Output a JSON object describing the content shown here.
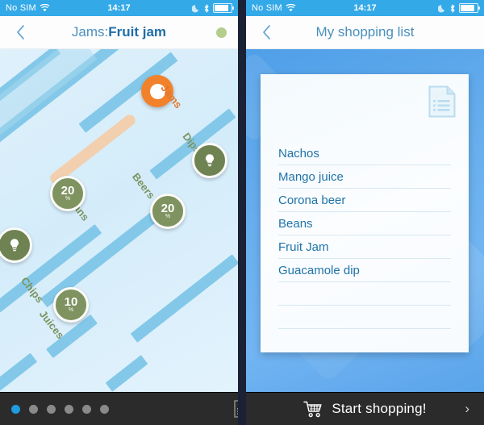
{
  "status_bar": {
    "carrier": "No SIM",
    "time": "14:17",
    "wifi_icon": "wifi-icon",
    "moon_icon": "moon-icon",
    "bluetooth_icon": "bluetooth-icon",
    "battery_icon": "battery-icon"
  },
  "left_panel": {
    "nav": {
      "back_icon": "chevron-left-icon",
      "title_prefix": "Jams:",
      "title_main": "Fruit jam",
      "status_dot_color": "#b5cd8d"
    },
    "map": {
      "labels": [
        {
          "text": "Jams",
          "highlight": true
        },
        {
          "text": "Dips",
          "highlight": false
        },
        {
          "text": "Cans",
          "highlight": false
        },
        {
          "text": "Beers",
          "highlight": false
        },
        {
          "text": "Chips",
          "highlight": false
        },
        {
          "text": "Juices",
          "highlight": false
        }
      ],
      "badges": [
        {
          "type": "discount",
          "value": "20",
          "unit": "%"
        },
        {
          "type": "discount",
          "value": "20",
          "unit": "%"
        },
        {
          "type": "discount",
          "value": "10",
          "unit": "%"
        },
        {
          "type": "idea",
          "icon": "lightbulb-icon"
        },
        {
          "type": "idea",
          "icon": "lightbulb-icon"
        }
      ],
      "marker": {
        "icon": "location-marker-icon",
        "color": "#f2812c"
      },
      "aisle_color": "#83c8e9",
      "floor_color": "#dff1fb"
    },
    "bottom_bar": {
      "page_dots": 6,
      "active_dot": 1,
      "list_icon": "document-list-icon"
    }
  },
  "right_panel": {
    "nav": {
      "back_icon": "chevron-left-icon",
      "title": "My shopping list"
    },
    "card": {
      "doc_icon": "document-list-icon",
      "items": [
        "Nachos",
        "Mango juice",
        "Corona beer",
        "Beans",
        "Fruit Jam",
        "Guacamole dip",
        "",
        ""
      ]
    },
    "bottom_bar": {
      "cart_icon": "shopping-cart-icon",
      "label": "Start shopping!",
      "chevron_icon": "chevron-right-icon"
    }
  }
}
